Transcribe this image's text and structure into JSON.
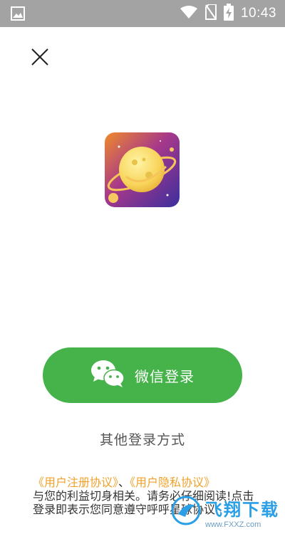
{
  "status_bar": {
    "time": "10:43",
    "icons": [
      "image-icon",
      "wifi-icon",
      "no-sim-icon",
      "battery-charging-icon"
    ]
  },
  "close_icon": "close-icon",
  "app_logo": "planet-logo",
  "wechat_login": {
    "label": "微信登录",
    "icon": "wechat-icon",
    "color": "#45b349"
  },
  "other_login_label": "其他登录方式",
  "agreement": {
    "user_agreement": "《用户注册协议》",
    "separator": "、",
    "privacy_agreement": "《用户隐私协议》",
    "text": "与您的利益切身相关。请务必仔细阅读!点击登录即表示您同意遵守呼呼星球协议",
    "link_color": "#f0a12a"
  },
  "watermark": {
    "brand": "飞翔下载",
    "url": "www.FXXZ.com"
  }
}
